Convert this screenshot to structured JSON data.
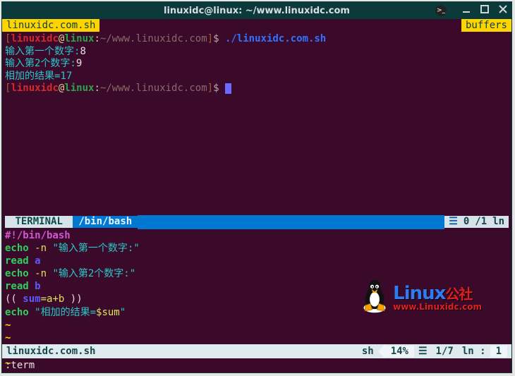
{
  "titlebar": {
    "title": "linuxidc@linux: ~/www.linuxidc.com"
  },
  "tabs": {
    "left": "linuxidc.com.sh",
    "right": "buffers"
  },
  "prompt": {
    "lb": "[",
    "rb": "]",
    "user": "linuxidc",
    "at": "@",
    "host": "linux",
    "colon": ":",
    "path": "~/www.linuxidc.com",
    "dollar": "$"
  },
  "term": {
    "cmd": "./linuxidc.com.sh",
    "l1a": "输入第一个数字:",
    "l1b": "8",
    "l2a": "输入第2个数字:",
    "l2b": "9",
    "l3": "相加的结果=17"
  },
  "mid": {
    "mode": "TERMINAL",
    "bin": "/bin/bash",
    "c0": "0",
    "c1": "/1",
    "ln": "ln"
  },
  "script": {
    "shebang": "#!/bin/bash",
    "echo": "echo",
    "n": "-n",
    "s1": "\"输入第一个数字:\"",
    "read": "read",
    "a": "a",
    "s2": "\"输入第2个数字:\"",
    "b": "b",
    "op": "((",
    "cp": "))",
    "sumv": "sum",
    "eq": "=",
    "plus": "+",
    "s3o": "\"相加的结果=",
    "sum": "$sum",
    "s3c": "\""
  },
  "tilde": "~",
  "botstatus": {
    "file": "linuxidc.com.sh",
    "ft": "sh",
    "pct": "14%",
    "hamburger": "☰",
    "pos": "1/7",
    "ln": "ln :",
    "col": "1"
  },
  "cmdline": ":term",
  "logo": {
    "t1a": "Linux",
    "t1b": "公社",
    "t2": "www.Linuxidc.com"
  }
}
